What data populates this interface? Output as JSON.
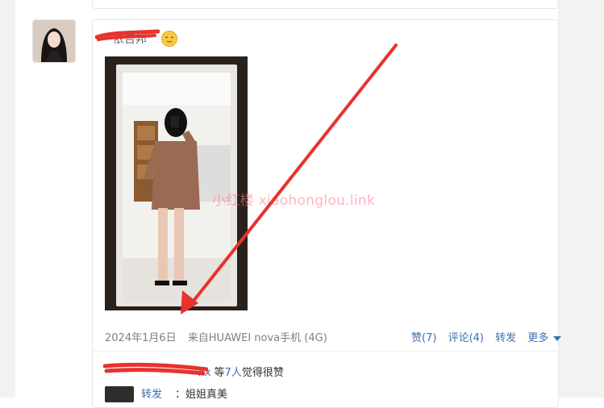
{
  "post": {
    "username": "依吉邦",
    "timestamp": "2024年1月6日",
    "source": "来自HUAWEI nova手机 (4G)",
    "watermark": "小红楼  xiaohonglou.link"
  },
  "actions": {
    "like": "赞(7)",
    "comment": "评论(4)",
    "repost": "转发",
    "more": "更多"
  },
  "likes": {
    "suffix_user": "xx",
    "connector": " 等",
    "count": "7人",
    "text": "觉得很赞"
  },
  "comment": {
    "user": "转发",
    "text": "：姐姐真美"
  },
  "icons": {
    "emoji": "smiley-emoji-icon",
    "more_caret": "caret-down-icon"
  },
  "colors": {
    "link": "#3a6fb0",
    "annotation_red": "#e8322e",
    "watermark": "#ff788c"
  }
}
